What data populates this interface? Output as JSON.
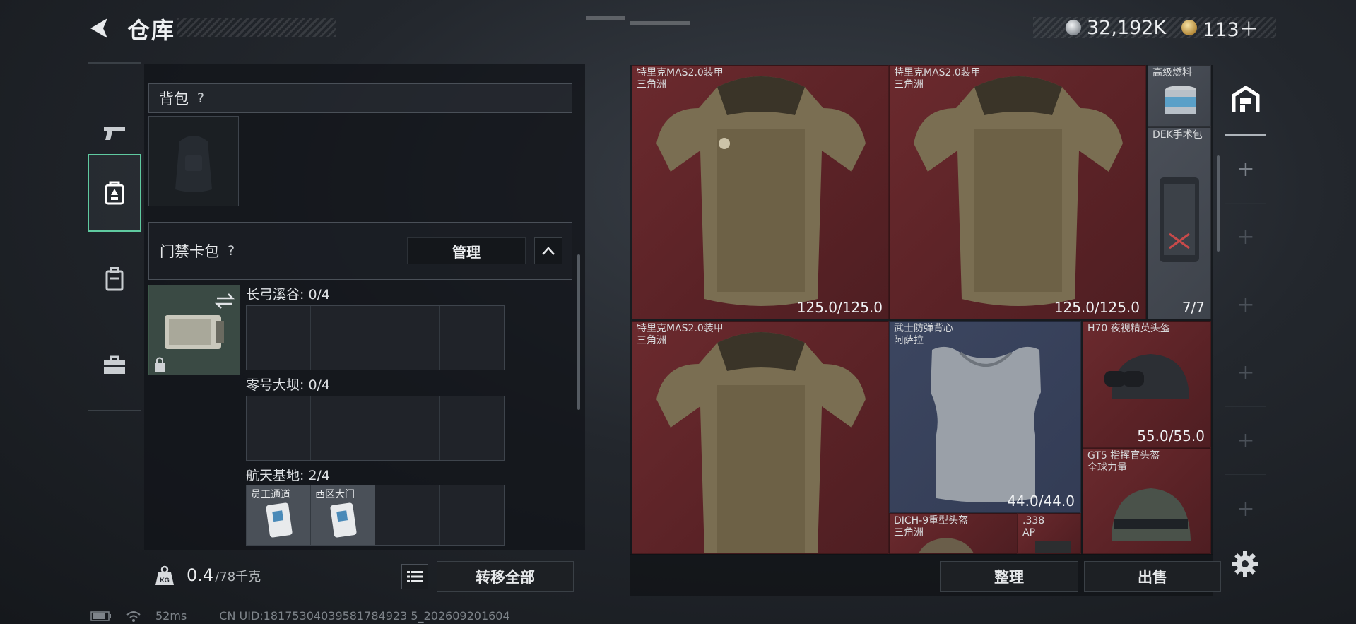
{
  "header": {
    "title": "仓库",
    "currencies": [
      {
        "icon": "silver-coin-icon",
        "value": "32,192K"
      },
      {
        "icon": "gold-coin-icon",
        "value": "113＋"
      }
    ]
  },
  "left_nav": {
    "items": [
      {
        "icon": "pistol-icon",
        "active": false
      },
      {
        "icon": "keycard-pack-icon",
        "active": true
      },
      {
        "icon": "case-icon",
        "active": false
      },
      {
        "icon": "toolbox-icon",
        "active": false
      }
    ]
  },
  "backpack": {
    "label": "背包",
    "help": "?"
  },
  "keycard_pack": {
    "label": "门禁卡包",
    "help": "?",
    "manage": "管理",
    "maps": [
      {
        "label": "长弓溪谷: 0/4",
        "cards": []
      },
      {
        "label": "零号大坝: 0/4",
        "cards": []
      },
      {
        "label": "航天基地: 2/4",
        "cards": [
          "员工通道",
          "西区大门"
        ]
      }
    ]
  },
  "footer_left": {
    "weight_current": "0.4",
    "weight_max": "/78千克",
    "transfer_all": "转移全部"
  },
  "inventory": {
    "items": [
      {
        "id": "vest1",
        "name": "特里克MAS2.0装甲\n三角洲",
        "durability": "125.0/125.0",
        "color": "red"
      },
      {
        "id": "vest2",
        "name": "特里克MAS2.0装甲\n三角洲",
        "durability": "125.0/125.0",
        "color": "red"
      },
      {
        "id": "fuel",
        "name": "高级燃料",
        "durability": "",
        "color": "grey"
      },
      {
        "id": "surgery",
        "name": "DEK手术包",
        "durability": "7/7",
        "color": "grey"
      },
      {
        "id": "vest3",
        "name": "特里克MAS2.0装甲\n三角洲",
        "durability": "",
        "color": "red"
      },
      {
        "id": "samurai",
        "name": "武士防弹背心\n阿萨拉",
        "durability": "44.0/44.0",
        "color": "blue"
      },
      {
        "id": "h70",
        "name": "H70 夜视精英头盔",
        "durability": "55.0/55.0",
        "color": "red"
      },
      {
        "id": "gt5",
        "name": "GT5 指挥官头盔\n全球力量",
        "durability": "",
        "color": "red"
      },
      {
        "id": "dich",
        "name": "DICH-9重型头盔\n三角洲",
        "durability": "",
        "color": "red"
      },
      {
        "id": "ammo",
        "name": ".338\nAP",
        "durability": "",
        "color": "red"
      }
    ],
    "sort": "整理",
    "sell": "出售"
  },
  "side_tabs": [
    "warehouse-icon",
    "plus-icon",
    "plus-icon",
    "plus-icon",
    "plus-icon",
    "plus-icon",
    "plus-icon"
  ],
  "status": {
    "ping": "52ms",
    "uid": "CN UID:18175304039581784923 5_202609201604"
  },
  "colors": {
    "accent": "#5fcaa0",
    "item_red": "#5a2226",
    "item_blue": "#333c55"
  }
}
